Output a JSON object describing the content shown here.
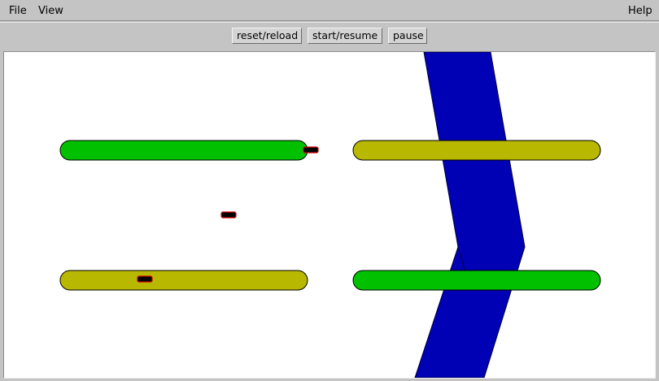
{
  "menu": {
    "file": "File",
    "view": "View",
    "help": "Help"
  },
  "toolbar": {
    "reset_label": "reset/reload",
    "start_label": "start/resume",
    "pause_label": "pause"
  },
  "colors": {
    "window_bg": "#c4c4c4",
    "canvas_bg": "#ffffff",
    "green_platform": "#00c000",
    "olive_platform": "#b8b800",
    "river": "#0000b4",
    "river_outline": "#000040",
    "object_fill": "#000000",
    "object_outline": "#d00000"
  },
  "scene": {
    "platforms": [
      {
        "name": "platform-green-left",
        "color": "green"
      },
      {
        "name": "platform-olive-right",
        "color": "olive"
      },
      {
        "name": "platform-olive-left",
        "color": "olive"
      },
      {
        "name": "platform-green-right",
        "color": "green"
      }
    ],
    "objects": [
      "object-1",
      "object-2",
      "object-3"
    ]
  }
}
